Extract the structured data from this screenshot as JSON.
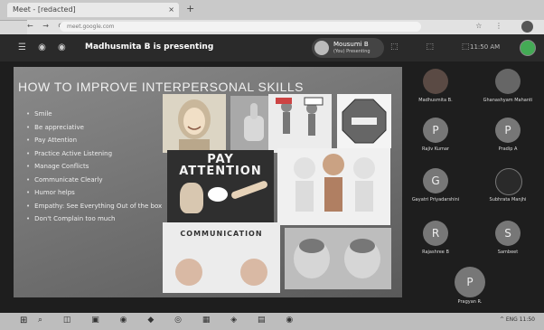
{
  "browser": {
    "tab_title": "Meet - [redacted]",
    "tab_close": "×",
    "new_tab": "+",
    "address": "meet.google.com",
    "nav_icons": "← → ⟳",
    "extension_icons": "☆ ⋮"
  },
  "meet_header": {
    "left_icons": "☰ ◉ ◉",
    "presenting_text": "Madhusmita B is presenting",
    "presenter_name": "Mousumi B",
    "presenter_sub": "(You) Presenting",
    "tools": "⬚ ⬚ ⬚",
    "time": "11:50 AM"
  },
  "slide": {
    "title": "HOW TO IMPROVE INTERPERSONAL SKILLS",
    "bullets": [
      "Smile",
      "Be appreciative",
      "Pay Attention",
      "Practice Active Listening",
      "Manage Conflicts",
      "Communicate Clearly",
      "Humor helps",
      "Empathy: See Everything Out of the box",
      "Don't Complain too much"
    ],
    "pay_attention": "PAY\nATTENTION",
    "communication": "COMMUNICATION"
  },
  "participants": [
    {
      "initial": "",
      "name": "Madhusmita B."
    },
    {
      "initial": "",
      "name": "Ghanashyam Mahanti"
    },
    {
      "initial": "P",
      "name": "Rajiv Kumar"
    },
    {
      "initial": "P",
      "name": "Pradip A"
    },
    {
      "initial": "G",
      "name": "Gayatri Priyadarshini"
    },
    {
      "initial": "",
      "name": "Subhrata Manjhi"
    },
    {
      "initial": "R",
      "name": "Rajashree B"
    },
    {
      "initial": "S",
      "name": "Sambeet"
    },
    {
      "initial": "P",
      "name": "Pragyan R."
    }
  ],
  "taskbar": {
    "start": "⊞",
    "icons": "⌕ ◫ ▣ ◉ ◆ ◎ ▦ ◈ ▤ ◉",
    "tray": "^ ENG 11:50"
  },
  "colors": {
    "meeting_bg": "#1e1e1e",
    "header_bg": "#2a2a2a",
    "slide_bg": "#7a7a7a"
  }
}
